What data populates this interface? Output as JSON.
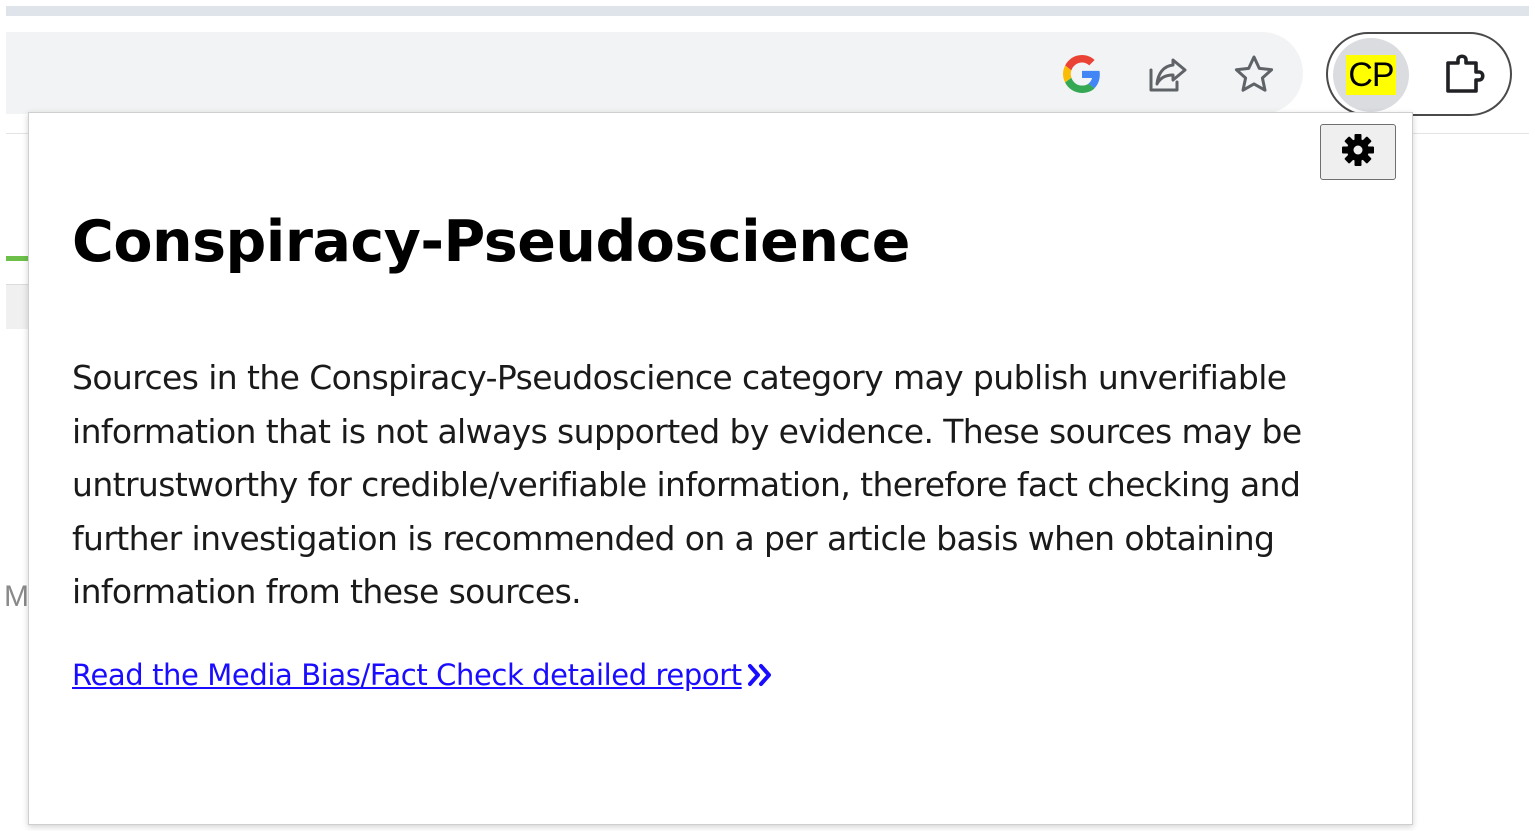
{
  "toolbar": {
    "icons": {
      "google": "google-icon",
      "share": "share-icon",
      "bookmark": "star-icon",
      "extensions": "puzzle-icon"
    },
    "extension_badge": "CP",
    "badge_color": "#ffff00"
  },
  "popup": {
    "settings_icon": "gear-icon",
    "title": "Conspiracy-Pseudoscience",
    "description": "Sources in the Conspiracy-Pseudoscience category may publish unverifiable information that is not always supported by evidence. These sources may be untrustworthy for credible/verifiable information, therefore fact checking and further investigation is recommended on a per article basis when obtaining information from these sources.",
    "link_text": "Read the Media Bias/Fact Check detailed report ",
    "link_icon": "double-chevron-right-icon",
    "link_color": "#1a0dff"
  },
  "background_page": {
    "partial_letter": "M"
  }
}
